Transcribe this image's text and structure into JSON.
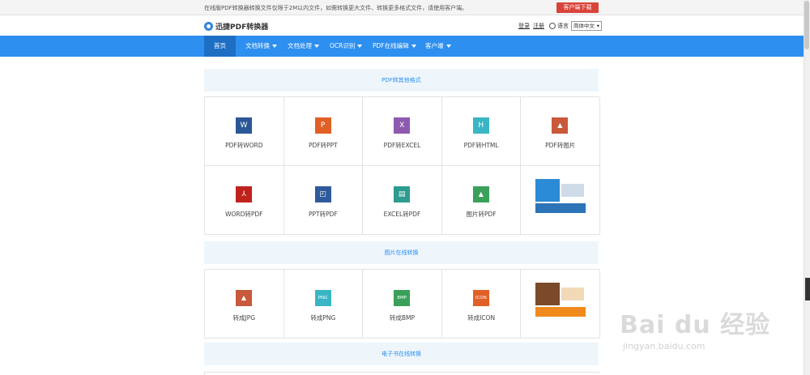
{
  "topbar": {
    "notice": "在线版PDF转换器转换文件仅限于2M以内文件，如需转换更大文件、转换更多格式文件，请使用客户端。",
    "download_label": "客户端下载"
  },
  "header": {
    "logo_text": "迅捷PDF转换器",
    "login": "登录",
    "register": "注册",
    "language_label": "语言",
    "language_value": "简体中文"
  },
  "nav": {
    "items": [
      {
        "label": "首页",
        "active": true
      },
      {
        "label": "文档转换",
        "dropdown": true
      },
      {
        "label": "文档处理",
        "dropdown": true
      },
      {
        "label": "OCR识别",
        "dropdown": true
      },
      {
        "label": "PDF在线编辑",
        "dropdown": true
      },
      {
        "label": "客户端",
        "dropdown": true
      }
    ]
  },
  "sections": [
    {
      "title": "PDF转其他格式",
      "tools": [
        {
          "label": "PDF转WORD",
          "glyph": "W",
          "color": "#2b5797",
          "icon": "word-icon"
        },
        {
          "label": "PDF转PPT",
          "glyph": "P",
          "color": "#e06027",
          "icon": "ppt-icon"
        },
        {
          "label": "PDF转EXCEL",
          "glyph": "X",
          "color": "#8e5ab0",
          "icon": "excel-x-icon"
        },
        {
          "label": "PDF转HTML",
          "glyph": "H",
          "color": "#3ab5c4",
          "icon": "html-icon"
        },
        {
          "label": "PDF转图片",
          "glyph": "▲",
          "color": "#c8593b",
          "icon": "image-icon"
        },
        {
          "label": "WORD转PDF",
          "glyph": "⅄",
          "color": "#c0221d",
          "icon": "pdf-icon"
        },
        {
          "label": "PPT转PDF",
          "glyph": "◰",
          "color": "#2f5b9c",
          "icon": "ppt-to-pdf-icon"
        },
        {
          "label": "EXCEL转PDF",
          "glyph": "▤",
          "color": "#2e9b8f",
          "icon": "excel-to-pdf-icon"
        },
        {
          "label": "图片转PDF",
          "glyph": "▲",
          "color": "#3aa05a",
          "icon": "image-to-pdf-icon"
        }
      ]
    },
    {
      "title": "图片在线转换",
      "tools": [
        {
          "label": "转成JPG",
          "glyph": "▲",
          "color": "#c8593b",
          "icon": "jpg-icon"
        },
        {
          "label": "转成PNG",
          "glyph": "PNG",
          "color": "#3ab5c4",
          "icon": "png-icon"
        },
        {
          "label": "转成BMP",
          "glyph": "BMP",
          "color": "#3aa05a",
          "icon": "bmp-icon"
        },
        {
          "label": "转成ICON",
          "glyph": "ICON",
          "color": "#e06027",
          "icon": "icon-format-icon"
        }
      ]
    },
    {
      "title": "电子书在线转换",
      "tools": []
    }
  ],
  "watermark": {
    "brand": "Bai du 经验",
    "url": "jingyan.baidu.com"
  }
}
